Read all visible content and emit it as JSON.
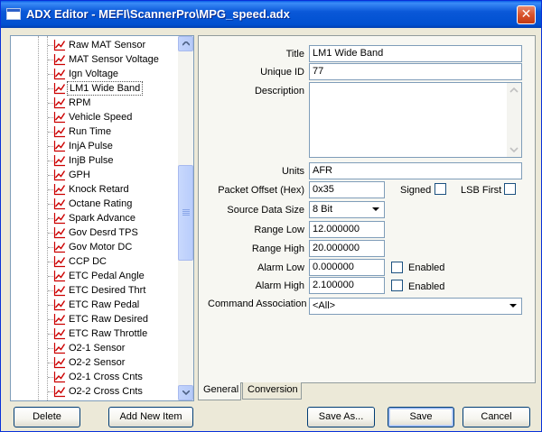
{
  "window": {
    "title": "ADX Editor - MEFI\\ScannerPro\\MPG_speed.adx",
    "close_label": "✕"
  },
  "tree": {
    "items": [
      {
        "label": "Raw MAT Sensor"
      },
      {
        "label": "MAT Sensor Voltage"
      },
      {
        "label": "Ign Voltage"
      },
      {
        "label": "LM1 Wide Band",
        "selected": true
      },
      {
        "label": "RPM"
      },
      {
        "label": "Vehicle Speed"
      },
      {
        "label": "Run Time"
      },
      {
        "label": "InjA Pulse"
      },
      {
        "label": "InjB Pulse"
      },
      {
        "label": "GPH"
      },
      {
        "label": "Knock Retard"
      },
      {
        "label": "Octane Rating"
      },
      {
        "label": "Spark Advance"
      },
      {
        "label": "Gov Desrd TPS"
      },
      {
        "label": "Gov Motor DC"
      },
      {
        "label": "CCP DC"
      },
      {
        "label": "ETC Pedal Angle"
      },
      {
        "label": "ETC Desired Thrt"
      },
      {
        "label": "ETC Raw Pedal"
      },
      {
        "label": "ETC Raw Desired"
      },
      {
        "label": "ETC Raw Throttle"
      },
      {
        "label": "O2-1 Sensor"
      },
      {
        "label": "O2-2 Sensor"
      },
      {
        "label": "O2-1 Cross Cnts"
      },
      {
        "label": "O2-2 Cross Cnts"
      }
    ],
    "scroll_fraction": 0.42
  },
  "form": {
    "title_label": "Title",
    "title_value": "LM1 Wide Band",
    "unique_id_label": "Unique ID",
    "unique_id_value": "77",
    "description_label": "Description",
    "description_value": "",
    "units_label": "Units",
    "units_value": "AFR",
    "packet_offset_label": "Packet Offset (Hex)",
    "packet_offset_value": "0x35",
    "signed_label": "Signed",
    "signed_checked": false,
    "lsb_first_label": "LSB First",
    "lsb_first_checked": false,
    "source_size_label": "Source Data Size",
    "source_size_value": "8 Bit",
    "range_low_label": "Range Low",
    "range_low_value": "12.000000",
    "range_high_label": "Range High",
    "range_high_value": "20.000000",
    "alarm_low_label": "Alarm Low",
    "alarm_low_value": "0.000000",
    "alarm_low_enabled_label": "Enabled",
    "alarm_high_label": "Alarm High",
    "alarm_high_value": "2.100000",
    "alarm_high_enabled_label": "Enabled",
    "command_assoc_label": "Command Association",
    "command_assoc_value": "<All>"
  },
  "tabs": {
    "general": "General",
    "conversion": "Conversion"
  },
  "buttons": {
    "delete": "Delete",
    "add_new_item": "Add New Item",
    "save_as": "Save As...",
    "save": "Save",
    "cancel": "Cancel"
  },
  "colors": {
    "titlebar": "#0058e6",
    "graph_icon": "#cc0000",
    "window_bg": "#ece9d8"
  }
}
